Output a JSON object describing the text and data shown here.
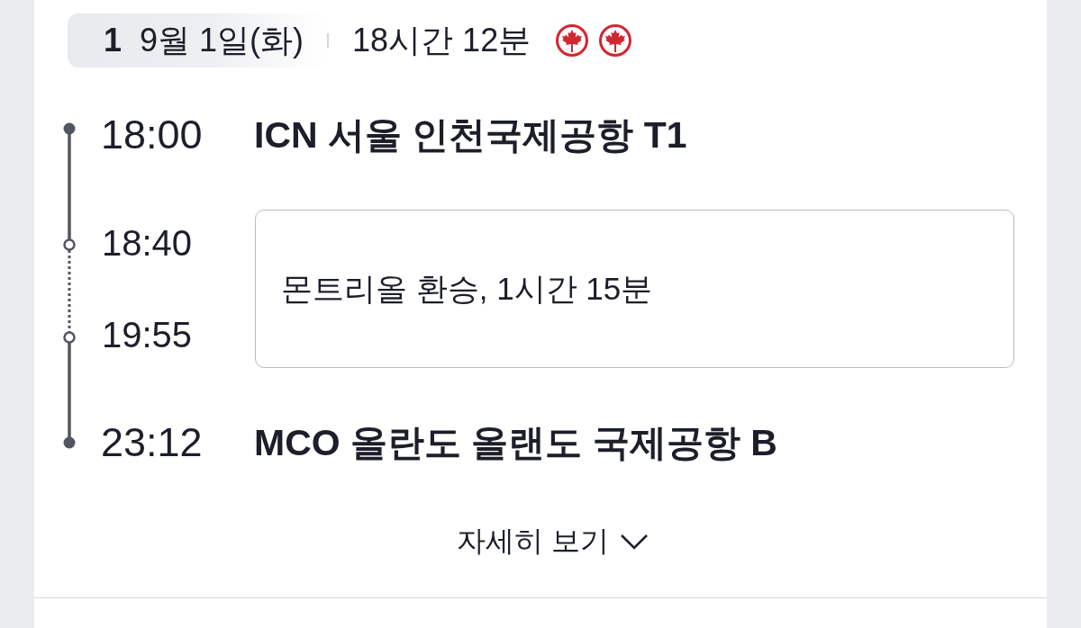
{
  "segment": {
    "number": "1",
    "date": "9월 1일(화)",
    "duration": "18시간 12분"
  },
  "timeline": [
    {
      "kind": "departure",
      "time": "18:00",
      "airport": "ICN 서울 인천국제공항 T1"
    },
    {
      "kind": "layover",
      "arrival_time": "18:40",
      "departure_time": "19:55",
      "note": "몬트리올 환승, 1시간 15분"
    },
    {
      "kind": "arrival",
      "time": "23:12",
      "airport": "MCO 올란도 올랜도 국제공항 B"
    }
  ],
  "details_toggle": {
    "label": "자세히 보기",
    "expanded": false
  }
}
